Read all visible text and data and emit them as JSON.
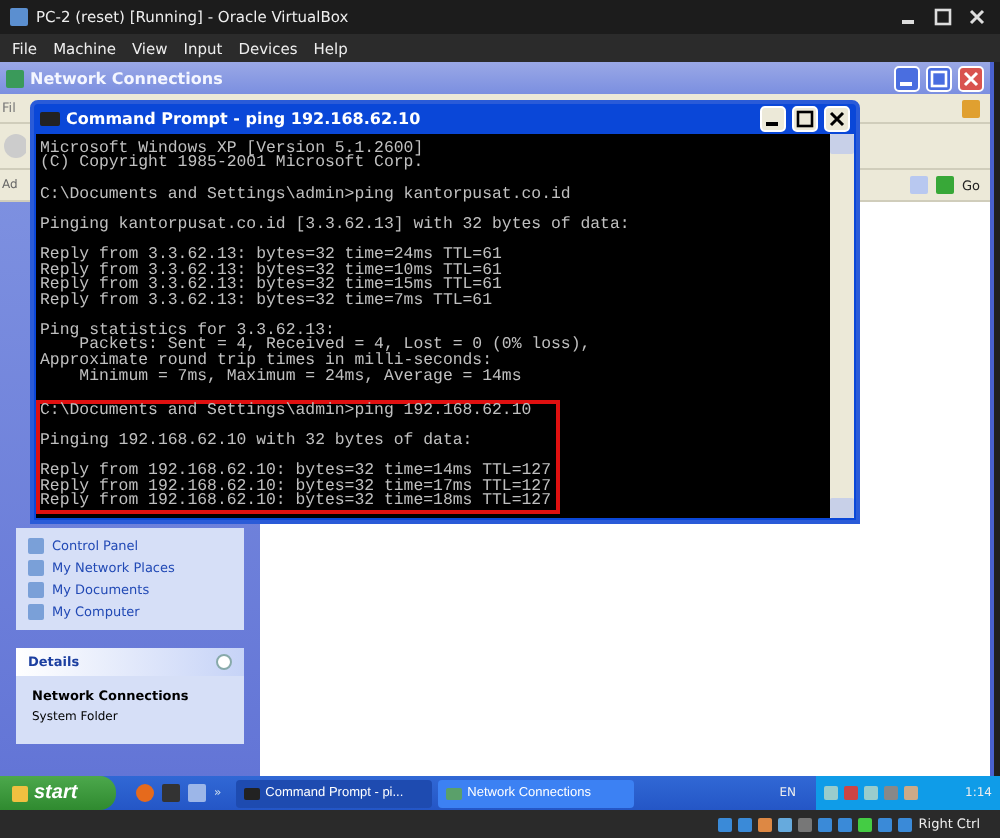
{
  "host": {
    "title": "PC-2 (reset) [Running] - Oracle VirtualBox",
    "menu": [
      "File",
      "Machine",
      "View",
      "Input",
      "Devices",
      "Help"
    ]
  },
  "explorer": {
    "title": "Network Connections",
    "menu_partial": "Fil",
    "address_partial": "Ad",
    "go": "Go",
    "tasks": [
      {
        "label": "Control Panel"
      },
      {
        "label": "My Network Places"
      },
      {
        "label": "My Documents"
      },
      {
        "label": "My Computer"
      }
    ],
    "details": {
      "heading": "Details",
      "name": "Network Connections",
      "type": "System Folder"
    }
  },
  "cmd": {
    "title": "Command Prompt - ping 192.168.62.10",
    "sections": [
      {
        "highlighted": false,
        "blocks": [
          [
            "Microsoft Windows XP [Version 5.1.2600]",
            "(C) Copyright 1985-2001 Microsoft Corp."
          ],
          [
            "C:\\Documents and Settings\\admin>ping kantorpusat.co.id"
          ],
          [
            "Pinging kantorpusat.co.id [3.3.62.13] with 32 bytes of data:"
          ],
          [
            "Reply from 3.3.62.13: bytes=32 time=24ms TTL=61",
            "Reply from 3.3.62.13: bytes=32 time=10ms TTL=61",
            "Reply from 3.3.62.13: bytes=32 time=15ms TTL=61",
            "Reply from 3.3.62.13: bytes=32 time=7ms TTL=61"
          ],
          [
            "Ping statistics for 3.3.62.13:",
            "    Packets: Sent = 4, Received = 4, Lost = 0 (0% loss),",
            "Approximate round trip times in milli-seconds:",
            "    Minimum = 7ms, Maximum = 24ms, Average = 14ms"
          ]
        ]
      },
      {
        "highlighted": true,
        "blocks": [
          [
            "C:\\Documents and Settings\\admin>ping 192.168.62.10"
          ],
          [
            "Pinging 192.168.62.10 with 32 bytes of data:"
          ],
          [
            "Reply from 192.168.62.10: bytes=32 time=14ms TTL=127",
            "Reply from 192.168.62.10: bytes=32 time=17ms TTL=127",
            "Reply from 192.168.62.10: bytes=32 time=18ms TTL=127"
          ]
        ]
      }
    ]
  },
  "taskbar": {
    "start": "start",
    "quick_more": "»",
    "tasks": [
      {
        "label": "Command Prompt - pi...",
        "selected": true
      },
      {
        "label": "Network Connections",
        "selected": false
      }
    ],
    "language": "EN",
    "clock": "1:14"
  },
  "status_bar": {
    "host_key": "Right Ctrl"
  }
}
